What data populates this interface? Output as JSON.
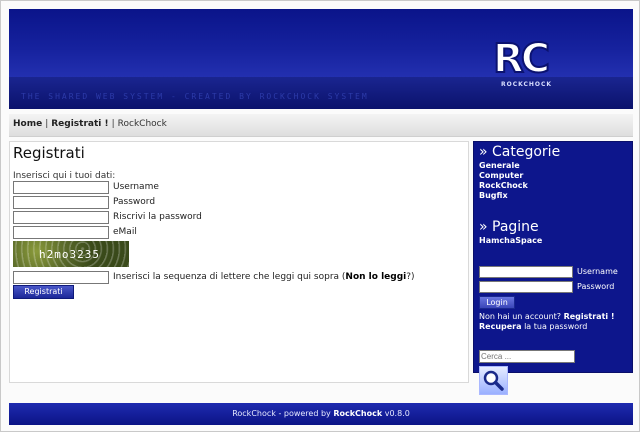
{
  "header": {
    "tagline": "THE  SHARED  WEB  SYSTEM  -  CREATED  BY  ROCKCHOCK  SYSTEM",
    "logo_text": "RC",
    "logo_brand": "ROCKCHOCK"
  },
  "breadcrumb": {
    "home": "Home",
    "separator": "|",
    "registrati": "Registrati !",
    "current": "RockChock"
  },
  "main": {
    "title": "Registrati",
    "intro": "Inserisci qui i tuoi dati:",
    "fields": {
      "username_label": "Username",
      "password_label": "Password",
      "repeat_password_label": "Riscrivi la password",
      "email_label": "eMail"
    },
    "captcha_text": "h2mo3235",
    "captcha_prompt_before": "Inserisci la sequenza di lettere che leggi qui sopra (",
    "captcha_link": "Non lo leggi",
    "captcha_prompt_after": "?)",
    "submit_label": "Registrati"
  },
  "sidebar": {
    "categories_title": "» Categorie",
    "categories": [
      "Generale",
      "Computer",
      "RockChock",
      "Bugfix"
    ],
    "pages_title": "» Pagine",
    "pages": [
      "HamchaSpace"
    ],
    "login": {
      "username_label": "Username",
      "password_label": "Password",
      "button_label": "Login",
      "no_account_text": "Non hai un account?",
      "register_link": "Registrati !",
      "recover_link": "Recupera",
      "recover_text": "la tua password"
    },
    "search": {
      "placeholder": "Cerca ...",
      "icon": "magnifier-icon"
    }
  },
  "footer": {
    "text_before": "RockChock - powered by",
    "brand": "RockChock",
    "version": "v0.8.0"
  },
  "colors": {
    "header_blue": "#16229e",
    "sidebar_blue": "#0d168c",
    "footer_blue": "#1f2bb0"
  }
}
